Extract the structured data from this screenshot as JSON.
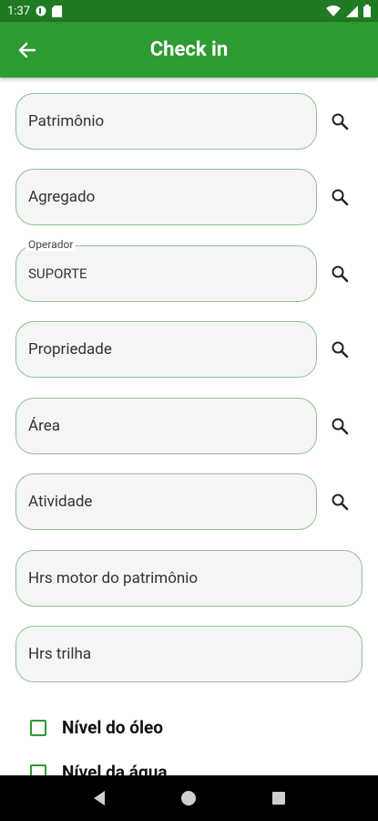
{
  "status_bar": {
    "time": "1:37"
  },
  "header": {
    "title": "Check in"
  },
  "fields": {
    "patrimonio": {
      "placeholder": "Patrimônio"
    },
    "agregado": {
      "placeholder": "Agregado"
    },
    "operador": {
      "label": "Operador",
      "value": "SUPORTE"
    },
    "propriedade": {
      "placeholder": "Propriedade"
    },
    "area": {
      "placeholder": "Área"
    },
    "atividade": {
      "placeholder": "Atividade"
    },
    "hrs_motor": {
      "placeholder": "Hrs motor do patrimônio"
    },
    "hrs_trilha": {
      "placeholder": "Hrs trilha"
    }
  },
  "checklist": [
    {
      "label": "Nível do óleo",
      "checked": false
    },
    {
      "label": "Nível da água",
      "checked": false
    }
  ],
  "colors": {
    "status_bar": "#1f7a22",
    "app_bar": "#2e9b32",
    "field_border": "#8bc48e",
    "field_bg": "#f5f5f5"
  },
  "icons": [
    "arrow-back-icon",
    "search-icon",
    "back-triangle-icon",
    "home-circle-icon",
    "recents-square-icon"
  ]
}
